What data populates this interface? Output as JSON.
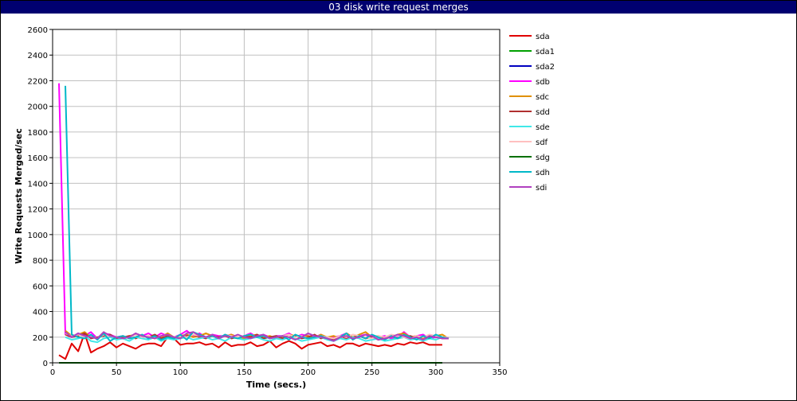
{
  "window": {
    "title": "03 disk write request merges"
  },
  "chart_data": {
    "type": "line",
    "title": "03 disk write request merges",
    "xlabel": "Time (secs.)",
    "ylabel": "Write Requests Merged/sec",
    "xlim": [
      0,
      350
    ],
    "ylim": [
      0,
      2600
    ],
    "xticks": [
      0,
      50,
      100,
      150,
      200,
      250,
      300,
      350
    ],
    "yticks": [
      0,
      200,
      400,
      600,
      800,
      1000,
      1200,
      1400,
      1600,
      1800,
      2000,
      2200,
      2400,
      2600
    ],
    "grid": true,
    "legend_position": "right",
    "series": [
      {
        "name": "sda",
        "color": "#e00000",
        "x": [
          5,
          10,
          15,
          20,
          25,
          30,
          35,
          40,
          45,
          50,
          55,
          60,
          65,
          70,
          75,
          80,
          85,
          90,
          95,
          100,
          105,
          110,
          115,
          120,
          125,
          130,
          135,
          140,
          145,
          150,
          155,
          160,
          165,
          170,
          175,
          180,
          185,
          190,
          195,
          200,
          205,
          210,
          215,
          220,
          225,
          230,
          235,
          240,
          245,
          250,
          255,
          260,
          265,
          270,
          275,
          280,
          285,
          290,
          295,
          300,
          305
        ],
        "y": [
          60,
          30,
          150,
          90,
          230,
          80,
          110,
          130,
          160,
          120,
          150,
          130,
          110,
          140,
          150,
          150,
          130,
          200,
          190,
          140,
          150,
          150,
          160,
          140,
          150,
          120,
          160,
          130,
          140,
          140,
          160,
          130,
          140,
          170,
          120,
          150,
          170,
          150,
          110,
          140,
          150,
          160,
          130,
          140,
          120,
          150,
          150,
          130,
          150,
          140,
          130,
          140,
          130,
          150,
          140,
          160,
          150,
          160,
          140,
          140,
          140
        ]
      },
      {
        "name": "sda1",
        "color": "#00a000",
        "x": [
          5,
          305
        ],
        "y": [
          0,
          0
        ]
      },
      {
        "name": "sda2",
        "color": "#0000c0",
        "x": [
          5,
          305
        ],
        "y": [
          0,
          0
        ]
      },
      {
        "name": "sdb",
        "color": "#ff00ff",
        "x": [
          5,
          10,
          15,
          20,
          25,
          30,
          35,
          40,
          45,
          50,
          55,
          60,
          65,
          70,
          75,
          80,
          85,
          90,
          95,
          100,
          105,
          110,
          115,
          120,
          125,
          130,
          135,
          140,
          145,
          150,
          155,
          160,
          165,
          170,
          175,
          180,
          185,
          190,
          195,
          200,
          205,
          210,
          215,
          220,
          225,
          230,
          235,
          240,
          245,
          250,
          255,
          260,
          265,
          270,
          275,
          280,
          285,
          290,
          295,
          300,
          305
        ],
        "y": [
          2180,
          220,
          200,
          230,
          210,
          240,
          190,
          230,
          220,
          200,
          210,
          190,
          200,
          210,
          230,
          200,
          230,
          210,
          200,
          220,
          250,
          210,
          230,
          200,
          220,
          210,
          210,
          220,
          200,
          210,
          230,
          200,
          220,
          200,
          210,
          210,
          230,
          200,
          220,
          210,
          200,
          220,
          190,
          200,
          210,
          230,
          200,
          210,
          220,
          190,
          200,
          210,
          190,
          200,
          240,
          200,
          210,
          220,
          190,
          200,
          200
        ]
      },
      {
        "name": "sdc",
        "color": "#e09000",
        "x": [
          10,
          15,
          20,
          25,
          30,
          35,
          40,
          45,
          50,
          55,
          60,
          65,
          70,
          75,
          80,
          85,
          90,
          95,
          100,
          105,
          110,
          115,
          120,
          125,
          130,
          135,
          140,
          145,
          150,
          155,
          160,
          165,
          170,
          175,
          180,
          185,
          190,
          195,
          200,
          205,
          210,
          215,
          220,
          225,
          230,
          235,
          240,
          245,
          250,
          255,
          260,
          265,
          270,
          275,
          280,
          285,
          290,
          295,
          300,
          305,
          310
        ],
        "y": [
          250,
          210,
          220,
          240,
          200,
          190,
          220,
          210,
          200,
          190,
          210,
          220,
          200,
          210,
          190,
          200,
          230,
          200,
          210,
          220,
          200,
          210,
          230,
          210,
          200,
          210,
          220,
          200,
          190,
          210,
          220,
          200,
          210,
          190,
          200,
          220,
          210,
          200,
          210,
          190,
          220,
          200,
          210,
          190,
          230,
          200,
          220,
          240,
          200,
          210,
          190,
          200,
          220,
          230,
          200,
          210,
          190,
          200,
          210,
          220,
          190
        ]
      },
      {
        "name": "sdd",
        "color": "#b03030",
        "x": [
          10,
          15,
          20,
          25,
          30,
          35,
          40,
          45,
          50,
          55,
          60,
          65,
          70,
          75,
          80,
          85,
          90,
          95,
          100,
          105,
          110,
          115,
          120,
          125,
          130,
          135,
          140,
          145,
          150,
          155,
          160,
          165,
          170,
          175,
          180,
          185,
          190,
          195,
          200,
          205,
          210,
          215,
          220,
          225,
          230,
          235,
          240,
          245,
          250,
          255,
          260,
          265,
          270,
          275,
          280,
          285,
          290,
          295,
          300,
          305,
          310
        ],
        "y": [
          220,
          200,
          210,
          230,
          190,
          200,
          210,
          220,
          190,
          200,
          210,
          190,
          210,
          200,
          220,
          190,
          210,
          200,
          190,
          210,
          220,
          200,
          190,
          210,
          200,
          210,
          190,
          200,
          210,
          200,
          220,
          190,
          200,
          210,
          190,
          200,
          210,
          190,
          200,
          220,
          190,
          200,
          180,
          210,
          190,
          200,
          210,
          190,
          200,
          180,
          200,
          210,
          190,
          200,
          210,
          190,
          180,
          200,
          210,
          190,
          190
        ]
      },
      {
        "name": "sde",
        "color": "#40e8e8",
        "x": [
          10,
          15,
          20,
          25,
          30,
          35,
          40,
          45,
          50,
          55,
          60,
          65,
          70,
          75,
          80,
          85,
          90,
          95,
          100,
          105,
          110,
          115,
          120,
          125,
          130,
          135,
          140,
          145,
          150,
          155,
          160,
          165,
          170,
          175,
          180,
          185,
          190,
          195,
          200,
          205,
          210,
          215,
          220,
          225,
          230,
          235,
          240,
          245,
          250,
          255,
          260,
          265,
          270,
          275,
          280,
          285,
          290,
          295,
          300,
          305,
          310
        ],
        "y": [
          200,
          180,
          190,
          210,
          170,
          160,
          190,
          200,
          180,
          190,
          170,
          200,
          190,
          180,
          200,
          170,
          190,
          180,
          190,
          200,
          180,
          190,
          200,
          180,
          190,
          170,
          200,
          190,
          180,
          190,
          200,
          180,
          170,
          190,
          180,
          200,
          190,
          170,
          180,
          190,
          200,
          180,
          170,
          190,
          180,
          200,
          190,
          170,
          180,
          190,
          170,
          180,
          190,
          200,
          180,
          190,
          170,
          190,
          180,
          200,
          190
        ]
      },
      {
        "name": "sdf",
        "color": "#ffc0c0",
        "x": [
          10,
          15,
          20,
          25,
          30,
          35,
          40,
          45,
          50,
          55,
          60,
          65,
          70,
          75,
          80,
          85,
          90,
          95,
          100,
          105,
          110,
          115,
          120,
          125,
          130,
          135,
          140,
          145,
          150,
          155,
          160,
          165,
          170,
          175,
          180,
          185,
          190,
          195,
          200,
          205,
          210,
          215,
          220,
          225,
          230,
          235,
          240,
          245,
          250,
          255,
          260,
          265,
          270,
          275,
          280,
          285,
          290,
          295,
          300,
          305,
          310
        ],
        "y": [
          230,
          210,
          220,
          200,
          210,
          190,
          220,
          210,
          200,
          210,
          190,
          220,
          200,
          210,
          190,
          210,
          220,
          200,
          210,
          200,
          220,
          210,
          200,
          210,
          190,
          220,
          210,
          200,
          210,
          220,
          200,
          210,
          190,
          200,
          210,
          220,
          200,
          210,
          190,
          200,
          210,
          200,
          190,
          210,
          200,
          220,
          210,
          200,
          190,
          210,
          200,
          220,
          210,
          200,
          190,
          210,
          200,
          220,
          210,
          200,
          200
        ]
      },
      {
        "name": "sdg",
        "color": "#007000",
        "x": [
          5,
          305
        ],
        "y": [
          0,
          0
        ]
      },
      {
        "name": "sdh",
        "color": "#00b8c8",
        "x": [
          10,
          15,
          20,
          25,
          30,
          35,
          40,
          45,
          50,
          55,
          60,
          65,
          70,
          75,
          80,
          85,
          90,
          95,
          100,
          105,
          110,
          115,
          120,
          125,
          130,
          135,
          140,
          145,
          150,
          155,
          160,
          165,
          170,
          175,
          180,
          185,
          190,
          195,
          200,
          205,
          210,
          215,
          220,
          225,
          230,
          235,
          240,
          245,
          250,
          255,
          260,
          265,
          270,
          275,
          280,
          285,
          290,
          295,
          300,
          305,
          310
        ],
        "y": [
          2160,
          220,
          200,
          190,
          220,
          180,
          230,
          170,
          200,
          210,
          190,
          200,
          220,
          190,
          210,
          180,
          200,
          190,
          220,
          180,
          240,
          220,
          200,
          210,
          190,
          220,
          200,
          190,
          210,
          220,
          200,
          210,
          190,
          200,
          210,
          180,
          220,
          200,
          190,
          200,
          210,
          190,
          170,
          200,
          230,
          180,
          210,
          190,
          220,
          200,
          180,
          210,
          190,
          220,
          200,
          180,
          210,
          190,
          220,
          200,
          190
        ]
      },
      {
        "name": "sdi",
        "color": "#b040c0",
        "x": [
          10,
          15,
          20,
          25,
          30,
          35,
          40,
          45,
          50,
          55,
          60,
          65,
          70,
          75,
          80,
          85,
          90,
          95,
          100,
          105,
          110,
          115,
          120,
          125,
          130,
          135,
          140,
          145,
          150,
          155,
          160,
          165,
          170,
          175,
          180,
          185,
          190,
          195,
          200,
          205,
          210,
          215,
          220,
          225,
          230,
          235,
          240,
          245,
          250,
          255,
          260,
          265,
          270,
          275,
          280,
          285,
          290,
          295,
          300,
          305,
          310
        ],
        "y": [
          240,
          200,
          230,
          210,
          200,
          190,
          240,
          210,
          200,
          190,
          200,
          230,
          210,
          200,
          190,
          210,
          220,
          200,
          190,
          230,
          240,
          210,
          200,
          220,
          190,
          210,
          200,
          220,
          200,
          190,
          210,
          220,
          190,
          200,
          210,
          200,
          180,
          200,
          230,
          210,
          200,
          190,
          170,
          200,
          210,
          190,
          200,
          220,
          210,
          180,
          190,
          200,
          220,
          210,
          190,
          200,
          180,
          210,
          200,
          190,
          190
        ]
      }
    ]
  }
}
